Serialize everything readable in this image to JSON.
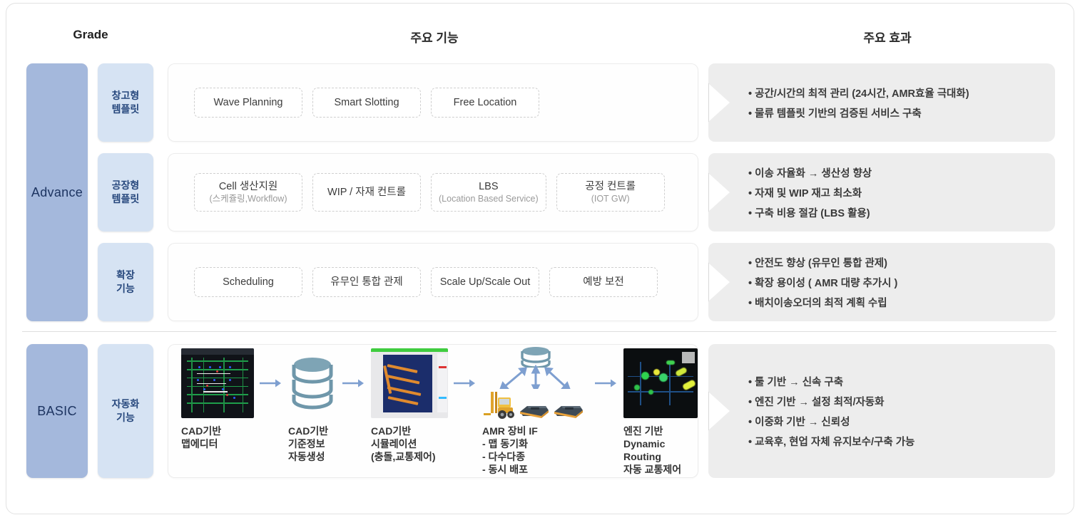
{
  "headers": {
    "grade": "Grade",
    "functions": "주요 기능",
    "effects": "주요 효과"
  },
  "grades": {
    "advance": "Advance",
    "basic": "BASIC"
  },
  "tiers": [
    {
      "label": "창고형\n템플릿"
    },
    {
      "label": "공장형\n템플릿"
    },
    {
      "label": "확장\n기능"
    },
    {
      "label": "자동화\n기능"
    }
  ],
  "rows": [
    {
      "chips": [
        {
          "title": "Wave Planning",
          "sub": ""
        },
        {
          "title": "Smart Slotting",
          "sub": ""
        },
        {
          "title": "Free Location",
          "sub": ""
        }
      ],
      "effects": [
        "공간/시간의 최적 관리 (24시간, AMR효율 극대화)",
        "물류 템플릿 기반의 검증된 서비스 구축"
      ]
    },
    {
      "chips": [
        {
          "title": "Cell 생산지원",
          "sub": "(스케쥴링,Workflow)"
        },
        {
          "title": "WIP / 자재 컨트롤",
          "sub": ""
        },
        {
          "title": "LBS",
          "sub": "(Location Based Service)"
        },
        {
          "title": "공정 컨트롤",
          "sub": "(IOT GW)"
        }
      ],
      "effects": [
        "이송 자율화 → 생산성 향상",
        "자재 및 WIP 재고 최소화",
        "구축 비용 절감 (LBS 활용)"
      ]
    },
    {
      "chips": [
        {
          "title": "Scheduling",
          "sub": ""
        },
        {
          "title": "유무인 통합 관제",
          "sub": ""
        },
        {
          "title": "Scale Up/Scale Out",
          "sub": ""
        },
        {
          "title": "예방 보전",
          "sub": ""
        }
      ],
      "effects": [
        "안전도 향상 (유무인 통합 관제)",
        "확장 용이성 ( AMR 대량 추가시 )",
        "배치이송오더의 최적 계획 수립"
      ]
    }
  ],
  "basic_row": {
    "pipeline": [
      {
        "icon": "cad-map-editor-thumbnail",
        "caption": "CAD기반\n맵에디터"
      },
      {
        "icon": "database-cylinder-icon",
        "caption": "CAD기반\n기준정보\n자동생성"
      },
      {
        "icon": "cad-simulation-thumbnail",
        "caption": "CAD기반\n시뮬레이션\n(충돌,교통제어)"
      },
      {
        "icon": "amr-equipment-group",
        "caption": "AMR 장비 IF\n- 맵 동기화\n- 다수다종\n- 동시 배포"
      },
      {
        "icon": "engine-routing-thumbnail",
        "caption": "엔진 기반\nDynamic Routing\n자동 교통제어"
      }
    ],
    "effects": [
      "툴 기반 → 신속 구축",
      "엔진 기반 → 설정 최적/자동화",
      "이중화 기반 → 신뢰성",
      "교육후, 현업 자체 유지보수/구축 가능"
    ]
  },
  "colors": {
    "grade_block": "#a4b8dc",
    "tier_block": "#d6e3f3",
    "effect_panel": "#ededed",
    "arrow": "#7e9fd0",
    "db_icon": "#6f97aa"
  }
}
